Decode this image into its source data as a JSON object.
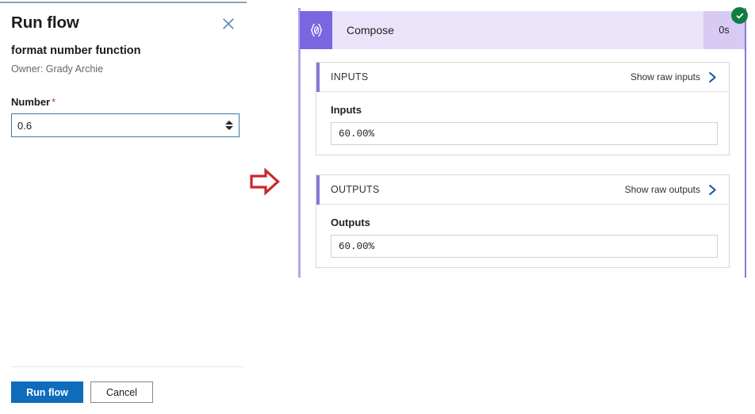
{
  "run_flow_panel": {
    "title": "Run flow",
    "close_icon": "close-icon",
    "flow_name": "format number function",
    "owner": "Owner: Grady Archie",
    "field": {
      "label": "Number",
      "required_marker": "*",
      "value": "0.6",
      "placeholder": "",
      "spinner_up_icon": "chevron-up-icon",
      "spinner_down_icon": "chevron-down-icon"
    },
    "actions": {
      "primary_label": "Run flow",
      "secondary_label": "Cancel"
    }
  },
  "annotation": {
    "arrow_icon": "arrow-right-icon",
    "arrow_color": "#c9282d"
  },
  "run_details": {
    "action": {
      "icon": "compose-braces-icon",
      "title": "Compose",
      "duration": "0s",
      "status_icon": "check-circle-icon",
      "status_color": "#107c41",
      "header_color": "#eae4fa",
      "icon_tile_color": "#7a66e0",
      "duration_color": "#d7cbf3"
    },
    "sections": [
      {
        "title": "INPUTS",
        "show_raw_label": "Show raw inputs",
        "chevron_icon": "chevron-right-icon",
        "field_caption": "Inputs",
        "field_value": "60.00%"
      },
      {
        "title": "OUTPUTS",
        "show_raw_label": "Show raw outputs",
        "chevron_icon": "chevron-right-icon",
        "field_caption": "Outputs",
        "field_value": "60.00%"
      }
    ]
  }
}
